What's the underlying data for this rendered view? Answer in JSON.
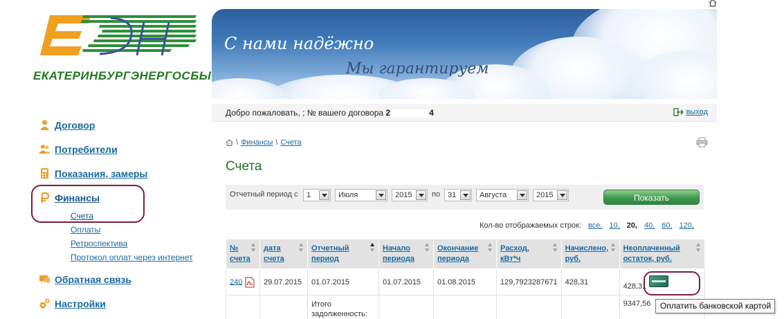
{
  "logo": {
    "text": "ЕКАТЕРИНБУРГЭНЕРГОСБЫТ"
  },
  "banner": {
    "slogan1": "С нами надёжно",
    "slogan2": "Мы гарантируем"
  },
  "sidebar": {
    "items": [
      {
        "label": "Договор",
        "icon": "person-icon"
      },
      {
        "label": "Потребители",
        "icon": "people-icon"
      },
      {
        "label": "Показания, замеры",
        "icon": "meter-icon"
      },
      {
        "label": "Финансы",
        "icon": "ruble-icon"
      },
      {
        "label": "Обратная связь",
        "icon": "chat-icon"
      },
      {
        "label": "Настройки",
        "icon": "gears-icon"
      }
    ],
    "finance_sub": [
      {
        "label": "Счета"
      },
      {
        "label": "Оплаты"
      },
      {
        "label": "Ретроспектива"
      },
      {
        "label": "Протокол оплат через интернет"
      }
    ]
  },
  "header": {
    "welcome_prefix": "Добро пожаловать, ; № вашего договора",
    "contract_first": "2",
    "contract_last": "4",
    "logout_label": "выход"
  },
  "breadcrumb": {
    "sep": "\\",
    "items": [
      "Финансы",
      "Счета"
    ]
  },
  "page": {
    "title": "Счета"
  },
  "filter": {
    "period_from_label": "Отчетный период с",
    "from_day": "1",
    "from_month": "Июля",
    "from_year": "2015",
    "to_label": "по",
    "to_day": "31",
    "to_month": "Августа",
    "to_year": "2015",
    "show_button": "Показать"
  },
  "rows_per_page": {
    "label": "Кол-во отображаемых строк:",
    "all": "все,",
    "opt10": "10,",
    "opt20": "20,",
    "opt40": "40,",
    "opt60": "60,",
    "opt120": "120,"
  },
  "table": {
    "headers": {
      "num": [
        "№",
        "счета"
      ],
      "date": [
        "дата",
        "счета"
      ],
      "period": [
        "Отчетный",
        "период"
      ],
      "start": [
        "Начало",
        "периода"
      ],
      "end": [
        "Окончание",
        "периода"
      ],
      "usage": [
        "Расход,",
        "кВт*ч"
      ],
      "charged": [
        "Начислено,",
        "руб."
      ],
      "unpaid": [
        "Неоплаченный",
        "остаток, руб."
      ]
    },
    "rows": [
      {
        "num": "240",
        "date": "29.07.2015",
        "period": "01.07.2015",
        "start": "01.07.2015",
        "end": "01.08.2015",
        "usage": "129,7923287671",
        "charged": "428,31",
        "unpaid": "428,31"
      }
    ],
    "total": {
      "label1": "Итого",
      "label2": "задолженность:",
      "value": "9347,56"
    }
  },
  "tooltip": {
    "text": "Оплатить банковской картой"
  },
  "colors": {
    "link": "#1c6a9e",
    "title_green": "#2a6f2a",
    "highlight_circle": "#7a1f3a",
    "button_green": "#3e9a4e"
  }
}
